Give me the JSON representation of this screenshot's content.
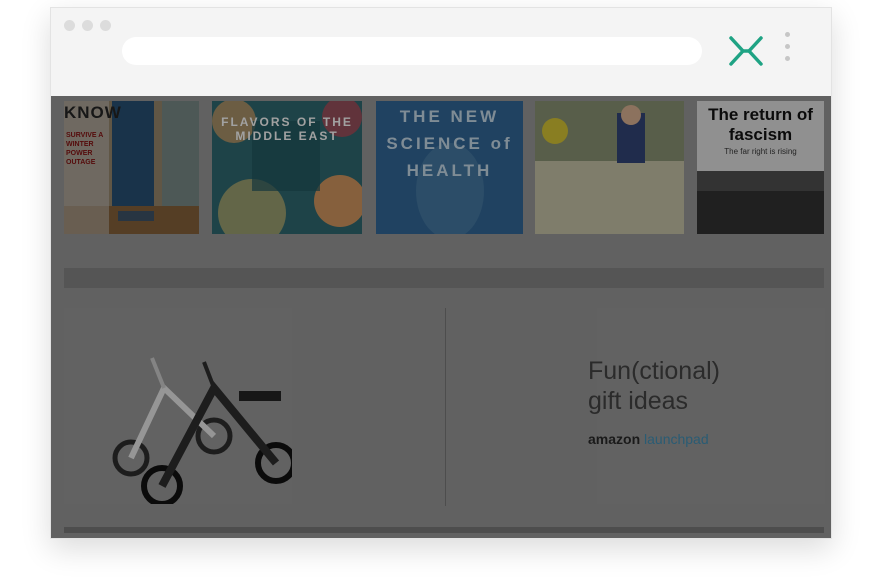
{
  "browser": {
    "window_dots": [
      "dot-1",
      "dot-2",
      "dot-3"
    ],
    "address_value": "",
    "close_icon": "close-x-icon",
    "menu_icon": "kebab-menu-icon",
    "accent": "#1fa384"
  },
  "magazines": [
    {
      "title": "KNOW",
      "tagline": "SURVIVE A WINTER POWER OUTAGE"
    },
    {
      "title": "FLAVORS OF THE MIDDLE EAST"
    },
    {
      "title": "THE NEW SCIENCE of HEALTH"
    },
    {
      "title": ""
    },
    {
      "title": "The return of fascism",
      "subtitle": "The far right is rising"
    }
  ],
  "promo": {
    "headline_line1": "Fun(ctional)",
    "headline_line2": "gift ideas",
    "brand": "amazon",
    "brand_suffix": "launchpad"
  }
}
